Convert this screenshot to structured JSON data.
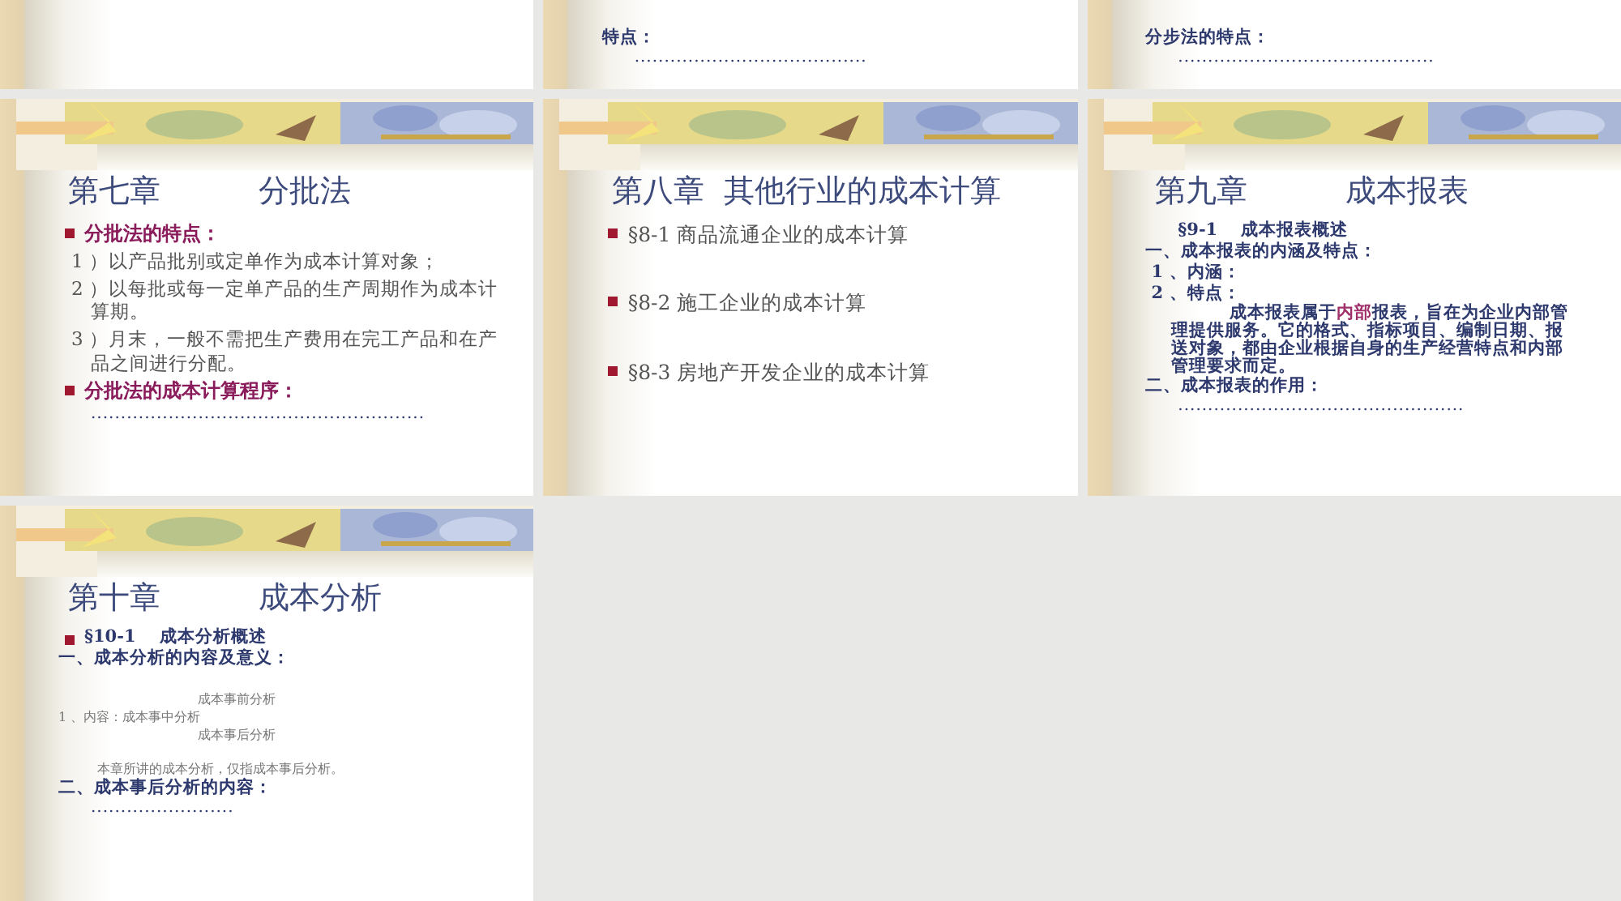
{
  "slides": [
    {
      "kind": "blank"
    },
    {
      "kind": "tail",
      "items": [
        {
          "kind": "blue-bold",
          "text": "特点："
        },
        {
          "kind": "dots",
          "text": "......................................."
        }
      ]
    },
    {
      "kind": "tail",
      "items": [
        {
          "kind": "blue-bold",
          "text": "分步法的特点："
        },
        {
          "kind": "dots",
          "text": "..........................................."
        }
      ]
    },
    {
      "kind": "chapter",
      "title": "第七章          分批法",
      "items": [
        {
          "kind": "heading",
          "text": "分批法的特点："
        },
        {
          "kind": "text",
          "text": "1 ）以产品批别或定单作为成本计算对象；"
        },
        {
          "kind": "text",
          "text": "2 ）以每批或每一定单产品的生产周期作为成本计算期。"
        },
        {
          "kind": "text",
          "text": "3 ）月末，一般不需把生产费用在完工产品和在产品之间进行分配。"
        },
        {
          "kind": "heading",
          "text": "分批法的成本计算程序："
        },
        {
          "kind": "dots",
          "text": "........................................................"
        }
      ]
    },
    {
      "kind": "chapter",
      "title": "第八章  其他行业的成本计算",
      "items": [
        {
          "kind": "bullet",
          "text": "§8-1 商品流通企业的成本计算"
        },
        {
          "kind": "bullet",
          "text": "§8-2 施工企业的成本计算"
        },
        {
          "kind": "bullet",
          "text": "§8-3 房地产开发企业的成本计算"
        }
      ]
    },
    {
      "kind": "chapter",
      "title": "第九章          成本报表",
      "items": [
        {
          "kind": "blue-bold-indent",
          "text": "§9-1    成本报表概述"
        },
        {
          "kind": "blue-bold",
          "text": "一、成本报表的内涵及特点："
        },
        {
          "kind": "blue-bold",
          "text": " 1 、内涵："
        },
        {
          "kind": "blue-bold",
          "text": " 2 、特点："
        },
        {
          "kind": "paragraph",
          "parts": [
            {
              "text": "成本报表属于",
              "highlight": false
            },
            {
              "text": "内部",
              "highlight": true
            },
            {
              "text": "报表，旨在为企业内部管理提供服务。它的格式、指标项目、编制日期、报送对象，都由企业根据自身的生产经营特点和内部管理要求而定。",
              "highlight": false
            }
          ]
        },
        {
          "kind": "blue-bold",
          "text": "二、成本报表的作用："
        },
        {
          "kind": "dots",
          "text": "................................................"
        }
      ]
    },
    {
      "kind": "chapter",
      "title": "第十章          成本分析",
      "items": [
        {
          "kind": "bullet-blue",
          "text": "§10-1    成本分析概述"
        },
        {
          "kind": "blue-bold",
          "text": "一、成本分析的内容及意义："
        },
        {
          "kind": "brace",
          "label": "1 、内容：",
          "options": [
            "成本事前分析",
            "成本事中分析",
            "成本事后分析"
          ]
        },
        {
          "kind": "note",
          "text": "本章所讲的成本分析，仅指成本事后分析。"
        },
        {
          "kind": "blue-bold",
          "text": "二、成本事后分析的内容："
        },
        {
          "kind": "dots",
          "text": "........................"
        }
      ]
    }
  ]
}
